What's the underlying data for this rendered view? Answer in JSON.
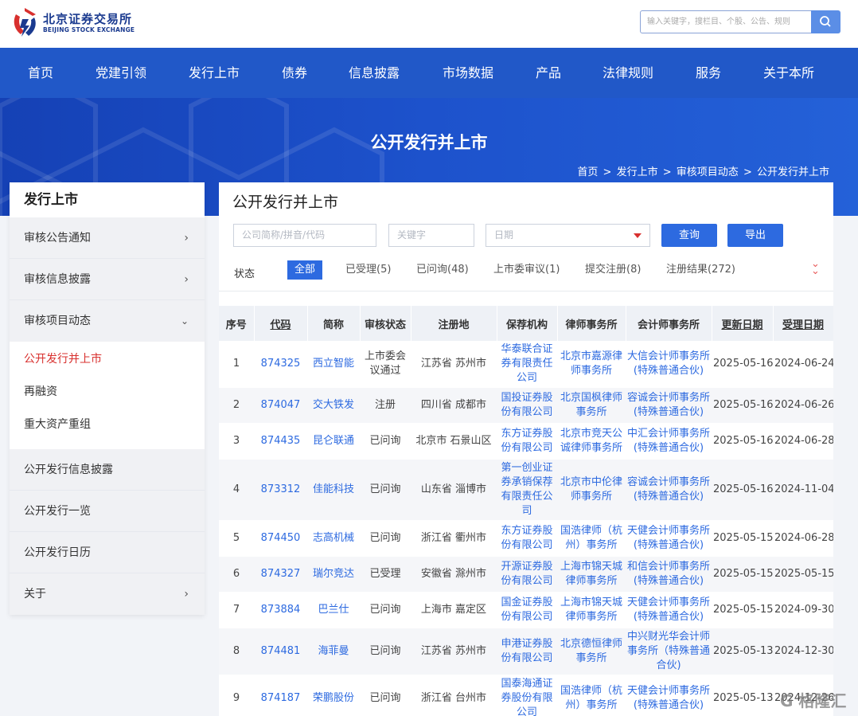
{
  "header": {
    "logo_cn": "北京证券交易所",
    "logo_en": "BEIJING STOCK EXCHANGE",
    "search_placeholder": "输入关键字，搜栏目、个股、公告、规则"
  },
  "nav": [
    "首页",
    "党建引领",
    "发行上市",
    "债券",
    "信息披露",
    "市场数据",
    "产品",
    "法律规则",
    "服务",
    "关于本所"
  ],
  "banner": {
    "title": "公开发行并上市",
    "breadcrumb": [
      "首页",
      "发行上市",
      "审核项目动态",
      "公开发行并上市"
    ]
  },
  "sidebar": {
    "title": "发行上市",
    "items_top": [
      "审核公告通知",
      "审核信息披露",
      "审核项目动态"
    ],
    "sub_items": [
      "公开发行并上市",
      "再融资",
      "重大资产重组"
    ],
    "items_bottom": [
      "公开发行信息披露",
      "公开发行一览",
      "公开发行日历",
      "关于"
    ]
  },
  "main": {
    "title": "公开发行并上市",
    "filters": {
      "code_placeholder": "公司简称/拼音/代码",
      "keyword_placeholder": "关键字",
      "date_placeholder": "日期",
      "query_label": "查询",
      "export_label": "导出"
    },
    "status_label": "状态",
    "statuses": [
      "全部",
      "已受理(5)",
      "已问询(48)",
      "上市委审议(1)",
      "提交注册(8)",
      "注册结果(272)"
    ],
    "expand_icon": "double-chevron-down",
    "columns": [
      "序号",
      "代码",
      "简称",
      "审核状态",
      "注册地",
      "保荐机构",
      "律师事务所",
      "会计师事务所",
      "更新日期",
      "受理日期"
    ],
    "rows": [
      [
        "1",
        "874325",
        "西立智能",
        "上市委会议通过",
        "江苏省 苏州市",
        "华泰联合证券有限责任公司",
        "北京市嘉源律师事务所",
        "大信会计师事务所(特殊普通合伙)",
        "2025-05-16",
        "2024-06-24"
      ],
      [
        "2",
        "874047",
        "交大铁发",
        "注册",
        "四川省 成都市",
        "国投证券股份有限公司",
        "北京国枫律师事务所",
        "容诚会计师事务所(特殊普通合伙)",
        "2025-05-16",
        "2024-06-26"
      ],
      [
        "3",
        "874435",
        "昆仑联通",
        "已问询",
        "北京市 石景山区",
        "东方证券股份有限公司",
        "北京市竞天公诚律师事务所",
        "中汇会计师事务所(特殊普通合伙)",
        "2025-05-16",
        "2024-06-28"
      ],
      [
        "4",
        "873312",
        "佳能科技",
        "已问询",
        "山东省 淄博市",
        "第一创业证券承销保荐有限责任公司",
        "北京市中伦律师事务所",
        "容诚会计师事务所(特殊普通合伙)",
        "2025-05-16",
        "2024-11-04"
      ],
      [
        "5",
        "874450",
        "志高机械",
        "已问询",
        "浙江省 衢州市",
        "东方证券股份有限公司",
        "国浩律师（杭州）事务所",
        "天健会计师事务所(特殊普通合伙)",
        "2025-05-15",
        "2024-06-28"
      ],
      [
        "6",
        "874327",
        "瑞尔竞达",
        "已受理",
        "安徽省 滁州市",
        "开源证券股份有限公司",
        "上海市锦天城律师事务所",
        "和信会计师事务所(特殊普通合伙)",
        "2025-05-15",
        "2025-05-15"
      ],
      [
        "7",
        "873884",
        "巴兰仕",
        "已问询",
        "上海市 嘉定区",
        "国金证券股份有限公司",
        "上海市锦天城律师事务所",
        "天健会计师事务所(特殊普通合伙)",
        "2025-05-15",
        "2024-09-30"
      ],
      [
        "8",
        "874481",
        "海菲曼",
        "已问询",
        "江苏省 苏州市",
        "申港证券股份有限公司",
        "北京德恒律师事务所",
        "中兴财光华会计师事务所（特殊普通合伙)",
        "2025-05-13",
        "2024-12-30"
      ],
      [
        "9",
        "874187",
        "荣鹏股份",
        "已问询",
        "浙江省 台州市",
        "国泰海通证券股份有限公司",
        "国浩律师（杭州）事务所",
        "天健会计师事务所(特殊普通合伙)",
        "2025-05-13",
        "2024-12-26"
      ]
    ]
  },
  "watermark": "格隆汇",
  "colors": {
    "nav_bg": "#2158c8",
    "accent": "#2d6ae0",
    "active_red": "#d8302e"
  }
}
